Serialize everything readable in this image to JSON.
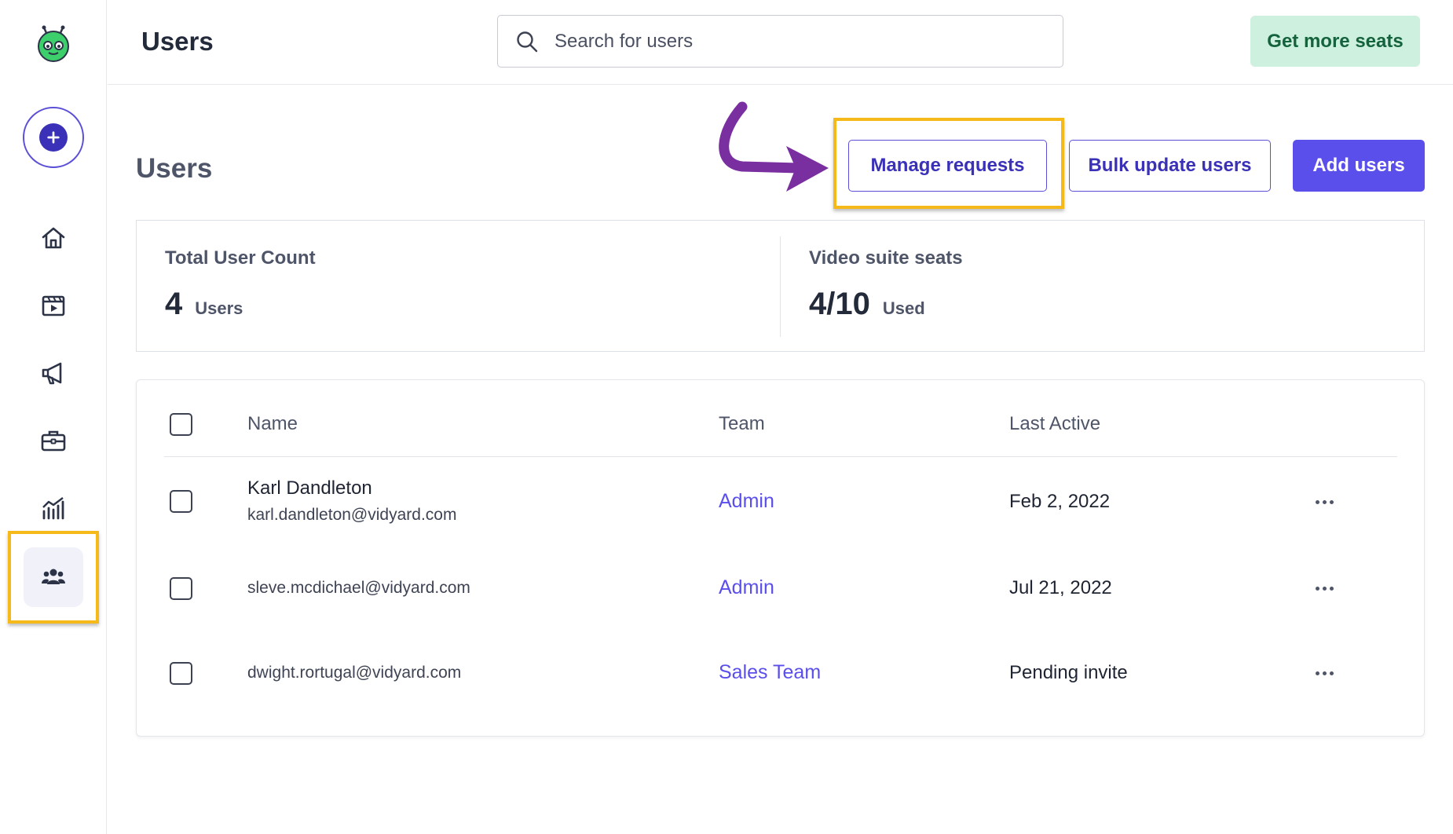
{
  "header": {
    "title": "Users",
    "search_placeholder": "Search for users",
    "get_more_seats_label": "Get more seats"
  },
  "sidebar": {
    "logo_icon": "vidyard-robot-logo",
    "create_icon": "plus-icon",
    "items": [
      {
        "icon": "home-icon",
        "label": "Home"
      },
      {
        "icon": "video-library-icon",
        "label": "Videos"
      },
      {
        "icon": "megaphone-icon",
        "label": "Campaigns"
      },
      {
        "icon": "briefcase-icon",
        "label": "Workspaces"
      },
      {
        "icon": "analytics-icon",
        "label": "Analytics"
      },
      {
        "icon": "users-icon",
        "label": "Users",
        "active": true
      }
    ]
  },
  "page": {
    "title": "Users",
    "manage_requests_label": "Manage requests",
    "bulk_update_label": "Bulk update users",
    "add_users_label": "Add users"
  },
  "stats": {
    "total_user_count": {
      "label": "Total User Count",
      "value": "4",
      "unit": "Users"
    },
    "video_suite_seats": {
      "label": "Video suite seats",
      "value": "4/10",
      "unit": "Used"
    }
  },
  "table": {
    "columns": [
      "Name",
      "Team",
      "Last Active"
    ],
    "rows": [
      {
        "name": "Karl Dandleton",
        "email": "karl.dandleton@vidyard.com",
        "team": "Admin",
        "last_active": "Feb 2, 2022"
      },
      {
        "name": "",
        "email": "sleve.mcdichael@vidyard.com",
        "team": "Admin",
        "last_active": "Jul 21, 2022"
      },
      {
        "name": "",
        "email": "dwight.rortugal@vidyard.com",
        "team": "Sales Team",
        "last_active": "Pending invite"
      }
    ]
  },
  "colors": {
    "accent": "#5b4fec",
    "accent_dark": "#3a31b8",
    "highlight": "#f5b91a",
    "arrow": "#7a2fa0",
    "seats_bg": "#cdf0df",
    "seats_text": "#15633d"
  }
}
